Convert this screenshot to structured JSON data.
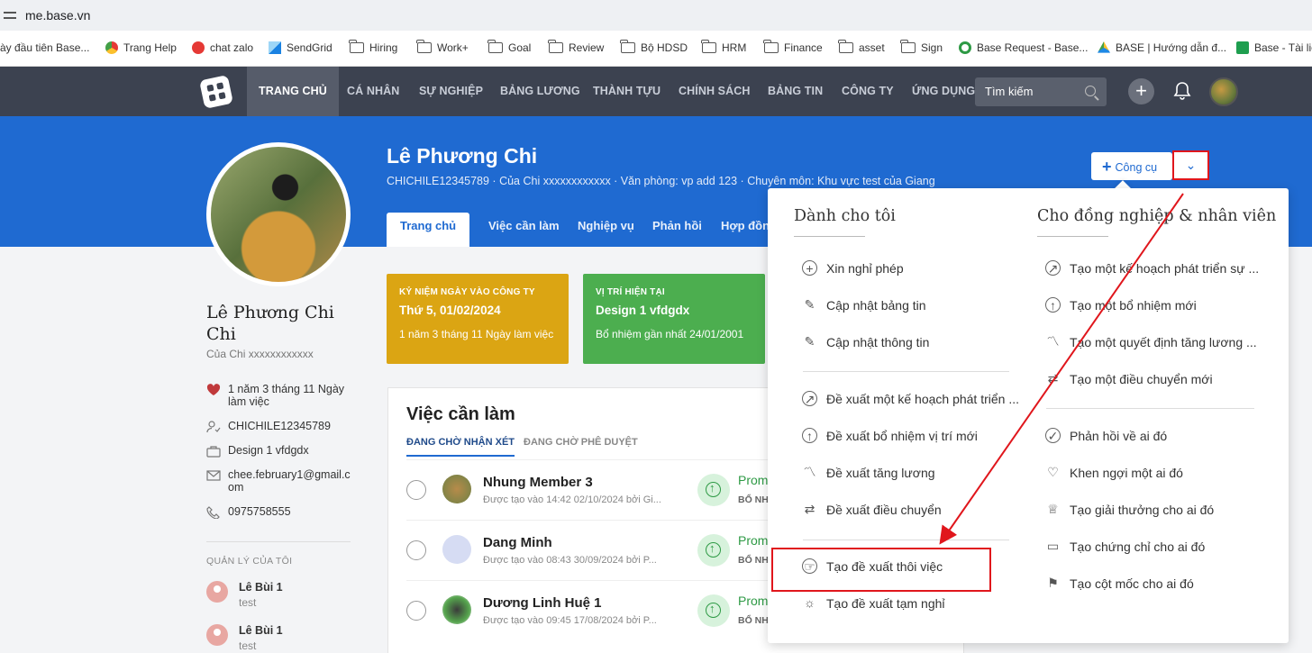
{
  "browser": {
    "url": "me.base.vn",
    "bookmarks": [
      {
        "label": "ày đầu tiên Base...",
        "icon": "none"
      },
      {
        "label": "Trang Help",
        "icon": "chrome-icon"
      },
      {
        "label": "chat zalo",
        "icon": "zalo-icon"
      },
      {
        "label": "SendGrid",
        "icon": "sendgrid-icon"
      },
      {
        "label": "Hiring",
        "icon": "folder-icon"
      },
      {
        "label": "Work+",
        "icon": "folder-icon"
      },
      {
        "label": "Goal",
        "icon": "folder-icon"
      },
      {
        "label": "Review",
        "icon": "folder-icon"
      },
      {
        "label": "Bộ HDSD",
        "icon": "folder-icon"
      },
      {
        "label": "HRM",
        "icon": "folder-icon"
      },
      {
        "label": "Finance",
        "icon": "folder-icon"
      },
      {
        "label": "asset",
        "icon": "folder-icon"
      },
      {
        "label": "Sign",
        "icon": "folder-icon"
      },
      {
        "label": "Base Request - Base...",
        "icon": "base-request-icon"
      },
      {
        "label": "BASE | Hướng dẫn đ...",
        "icon": "drive-icon"
      },
      {
        "label": "Base - Tài liệ",
        "icon": "sheets-icon"
      }
    ]
  },
  "nav": {
    "items": [
      "TRANG CHỦ",
      "CÁ NHÂN",
      "SỰ NGHIỆP",
      "BẢNG LƯƠNG",
      "THÀNH TỰU",
      "CHÍNH SÁCH",
      "BẢNG TIN",
      "CÔNG TY",
      "ỨNG DỤNG"
    ],
    "search_placeholder": "Tìm kiếm"
  },
  "profile": {
    "name": "Lê Phương Chi",
    "subline": "CHICHILE12345789 · Của Chi xxxxxxxxxxxx · Văn phòng: vp add 123 · Chuyên môn: Khu vực test của Giang",
    "tabs": [
      "Trang chủ",
      "Việc cần làm",
      "Nghiệp vụ",
      "Phản hồi",
      "Hợp đồn"
    ],
    "tool_button": "Công cụ",
    "side_name": "Lê Phương Chi Chi",
    "side_company": "Của Chi xxxxxxxxxxxx",
    "info": [
      {
        "icon": "heart-icon",
        "text": "1 năm 3 tháng 11 Ngày làm việc"
      },
      {
        "icon": "user-check-icon",
        "text": "CHICHILE12345789"
      },
      {
        "icon": "briefcase-icon",
        "text": "Design 1 vfdgdx"
      },
      {
        "icon": "mail-icon",
        "text": "chee.february1@gmail.com"
      },
      {
        "icon": "phone-icon",
        "text": "0975758555"
      }
    ],
    "managers_title": "QUẢN LÝ CỦA TÔI",
    "managers": [
      {
        "name": "Lê Bùi 1",
        "sub": "test"
      },
      {
        "name": "Lê Bùi 1",
        "sub": "test"
      }
    ]
  },
  "cards": [
    {
      "title": "KỶ NIỆM NGÀY VÀO CÔNG TY",
      "value": "Thứ 5, 01/02/2024",
      "sub": "1 năm 3 tháng 11 Ngày làm việc",
      "color": "#dba513"
    },
    {
      "title": "VỊ TRÍ HIỆN TẠI",
      "value": "Design 1 vfdgdx",
      "sub": "Bổ nhiệm gần nhất 24/01/2001",
      "color": "#4cae4f"
    }
  ],
  "todo": {
    "title": "Việc cần làm",
    "tabs": [
      "ĐANG CHỜ NHẬN XÉT",
      "ĐANG CHỜ PHÊ DUYỆT"
    ],
    "rows": [
      {
        "name": "Nhung Member 3",
        "sub": "Được tạo vào 14:42 02/10/2024 bởi Gi...",
        "status": "Prom",
        "status2": "BỔ NH"
      },
      {
        "name": "Dang Minh",
        "sub": "Được tạo vào 08:43 30/09/2024 bởi P...",
        "status": "Prom",
        "status2": "BỔ NH"
      },
      {
        "name": "Dương Linh Huệ 1",
        "sub": "Được tạo vào 09:45 17/08/2024 bởi P...",
        "status": "Prom",
        "status2": "BỔ NH"
      }
    ]
  },
  "dropdown": {
    "left_title": "Dành cho tôi",
    "right_title": "Cho đồng nghiệp & nhân viên",
    "left_items": [
      {
        "icon": "plus-circle-icon",
        "label": "Xin nghỉ phép"
      },
      {
        "icon": "edit-icon",
        "label": "Cập nhật bảng tin"
      },
      {
        "icon": "edit-icon",
        "label": "Cập nhật thông tin"
      },
      {
        "icon": "arrow-up-right-circle-icon",
        "label": "Đề xuất một kế hoạch phát triển ..."
      },
      {
        "icon": "arrow-up-circle-icon",
        "label": "Đề xuất bổ nhiệm vị trí mới"
      },
      {
        "icon": "trend-icon",
        "label": "Đề xuất tăng lương"
      },
      {
        "icon": "transfer-icon",
        "label": "Đề xuất điều chuyển"
      },
      {
        "icon": "resign-icon",
        "label": "Tạo đề xuất thôi việc"
      },
      {
        "icon": "pause-sun-icon",
        "label": "Tạo đề xuất tạm nghỉ"
      }
    ],
    "right_items": [
      {
        "icon": "arrow-up-right-circle-icon",
        "label": "Tạo một kế hoạch phát triển sự ..."
      },
      {
        "icon": "arrow-up-circle-icon",
        "label": "Tạo một bổ nhiệm mới"
      },
      {
        "icon": "trend-icon",
        "label": "Tạo một quyết định tăng lương ..."
      },
      {
        "icon": "transfer-icon",
        "label": "Tạo một điều chuyển mới"
      },
      {
        "icon": "check-circle-icon",
        "label": "Phản hồi về ai đó"
      },
      {
        "icon": "heart-outline-icon",
        "label": "Khen ngợi một ai đó"
      },
      {
        "icon": "award-icon",
        "label": "Tạo giải thưởng cho ai đó"
      },
      {
        "icon": "certificate-icon",
        "label": "Tạo chứng chỉ cho ai đó"
      },
      {
        "icon": "milestone-icon",
        "label": "Tạo cột mốc cho ai đó"
      }
    ]
  },
  "colors": {
    "accent": "#1f6ad1",
    "nav_bg": "#3c4250",
    "highlight": "#e0161c"
  }
}
